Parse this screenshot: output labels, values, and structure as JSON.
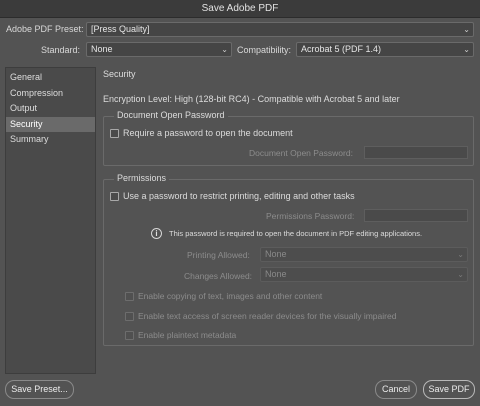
{
  "window": {
    "title": "Save Adobe PDF"
  },
  "header": {
    "preset_label": "Adobe PDF Preset:",
    "preset_value": "[Press Quality]",
    "standard_label": "Standard:",
    "standard_value": "None",
    "compat_label": "Compatibility:",
    "compat_value": "Acrobat 5 (PDF 1.4)"
  },
  "sidebar": {
    "items": [
      {
        "label": "General"
      },
      {
        "label": "Compression"
      },
      {
        "label": "Output"
      },
      {
        "label": "Security"
      },
      {
        "label": "Summary"
      }
    ],
    "active": "Security"
  },
  "security": {
    "title": "Security",
    "encryption_text": "Encryption Level: High (128-bit RC4) - Compatible with Acrobat 5 and later",
    "open_group": {
      "title": "Document Open Password",
      "require_label": "Require a password to open the document",
      "password_label": "Document Open Password:"
    },
    "permissions_group": {
      "title": "Permissions",
      "use_password_label": "Use a password to restrict printing, editing and other tasks",
      "password_label": "Permissions Password:",
      "info_text": "This password is required to open the document in PDF editing applications.",
      "printing_label": "Printing Allowed:",
      "printing_value": "None",
      "changes_label": "Changes Allowed:",
      "changes_value": "None",
      "enable_copy_label": "Enable copying of text, images and other content",
      "enable_access_label": "Enable text access of screen reader devices for the visually impaired",
      "enable_metadata_label": "Enable plaintext metadata"
    }
  },
  "footer": {
    "save_preset": "Save Preset...",
    "cancel": "Cancel",
    "save_pdf": "Save PDF"
  },
  "icons": {
    "chevron": "chevron-down-icon",
    "info": "info-icon"
  }
}
